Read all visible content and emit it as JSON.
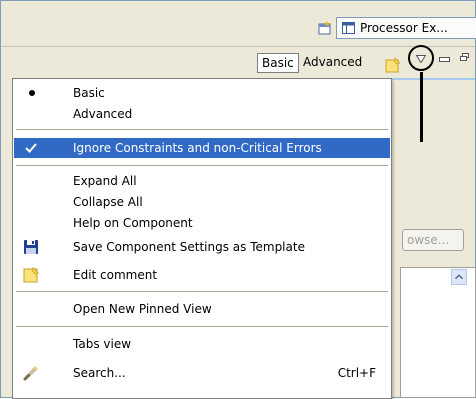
{
  "perspective_bar": {
    "open_perspective_icon": "open-perspective-icon",
    "perspective_button_label": "Processor Ex..."
  },
  "view_toolbar": {
    "basic_label": "Basic",
    "advanced_label": "Advanced",
    "comment_icon": "note-icon",
    "view_menu_icon": "view-menu-chevron-icon",
    "minimize_icon": "minimize-icon",
    "maximize_icon": "maximize-icon"
  },
  "background": {
    "browse_button_label": "owse..."
  },
  "menu": {
    "items": {
      "basic": "Basic",
      "advanced": "Advanced",
      "ignore_constraints": "Ignore Constraints and non-Critical Errors",
      "expand_all": "Expand All",
      "collapse_all": "Collapse All",
      "help_on_component": "Help on Component",
      "save_template": "Save Component Settings as Template",
      "edit_comment": "Edit comment",
      "open_pinned_view": "Open New Pinned View",
      "tabs_view": "Tabs view",
      "search": "Search...",
      "search_shortcut": "Ctrl+F"
    },
    "selected_mode": "Basic",
    "checked_item": "Ignore Constraints and non-Critical Errors",
    "highlight_color": "#316ac5"
  }
}
